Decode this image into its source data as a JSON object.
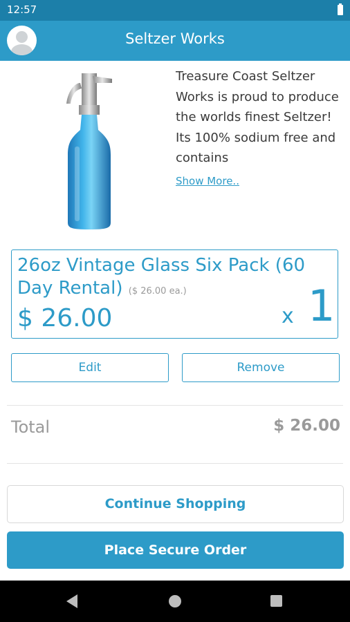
{
  "status_bar": {
    "time": "12:57"
  },
  "app_bar": {
    "title": "Seltzer Works"
  },
  "product": {
    "description": "Treasure Coast Seltzer Works is proud to produce the worlds finest Seltzer! Its 100% sodium free and contains",
    "show_more": "Show More.."
  },
  "cart_item": {
    "name": "26oz Vintage Glass Six Pack (60 Day Rental)",
    "unit_price": "($ 26.00 ea.)",
    "price": "$ 26.00",
    "qty_prefix": "x",
    "quantity": "1"
  },
  "actions": {
    "edit_label": "Edit",
    "remove_label": "Remove"
  },
  "summary": {
    "total_label": "Total",
    "total_value": "$ 26.00"
  },
  "buttons": {
    "continue_label": "Continue Shopping",
    "order_label": "Place Secure Order"
  },
  "colors": {
    "primary": "#2d9bc8",
    "status_bar": "#1c7fa9",
    "muted": "#9a9a9a"
  },
  "icons": {
    "avatar": "person-icon",
    "battery": "battery-icon",
    "nav": [
      "back-icon",
      "home-icon",
      "recent-apps-icon"
    ]
  }
}
